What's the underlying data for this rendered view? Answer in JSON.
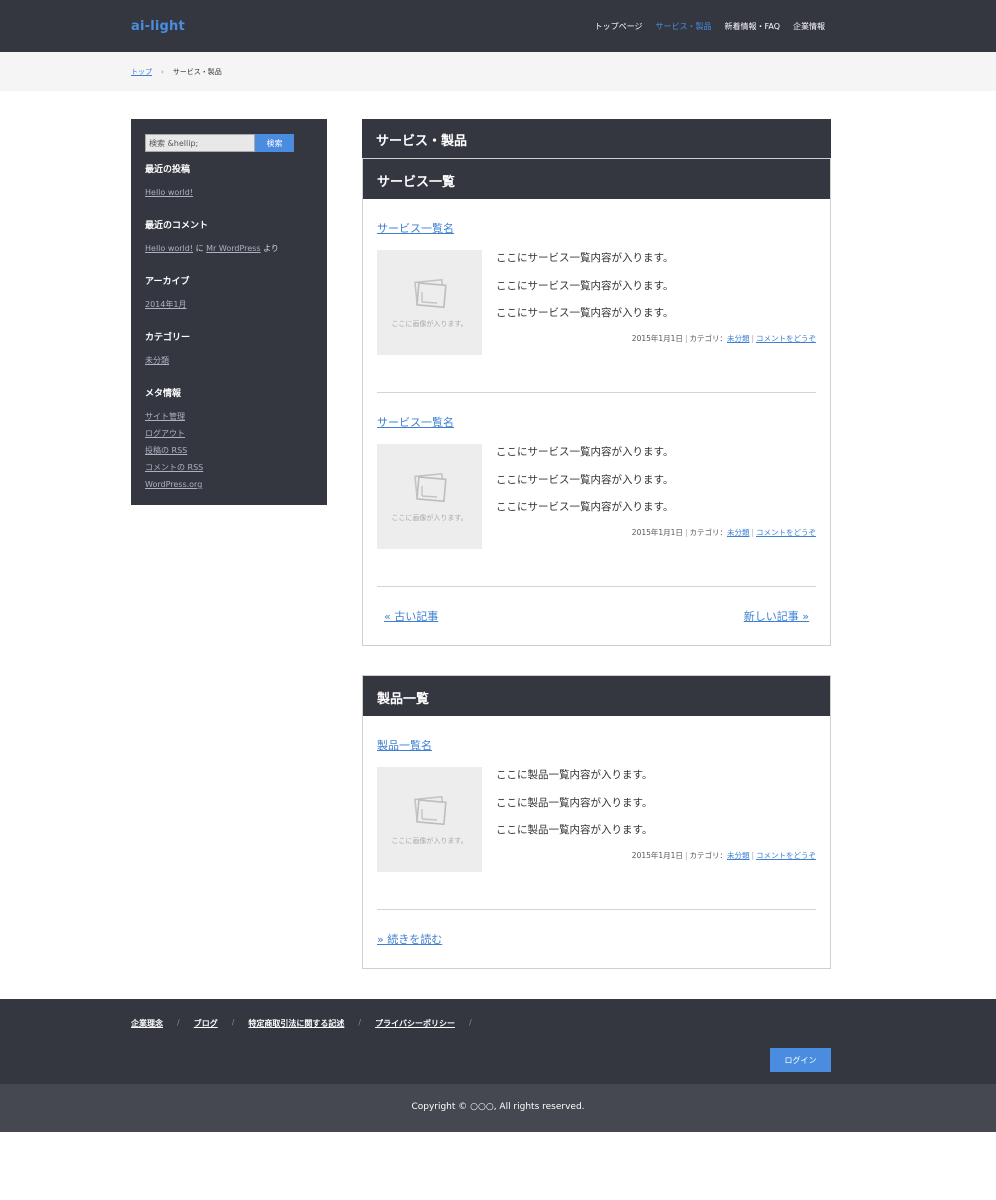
{
  "header": {
    "logo": "ai-light",
    "nav": [
      {
        "label": "トップページ",
        "active": false
      },
      {
        "label": "サービス・製品",
        "active": true
      },
      {
        "label": "新着情報・FAQ",
        "active": false
      },
      {
        "label": "企業情報",
        "active": false
      }
    ]
  },
  "breadcrumb": {
    "home": "トップ",
    "separator": "›",
    "current": "サービス・製品"
  },
  "sidebar": {
    "search": {
      "placeholder": "検索 &hellip;",
      "button": "検索"
    },
    "recent_posts": {
      "title": "最近の投稿",
      "items": [
        "Hello world!"
      ]
    },
    "recent_comments": {
      "title": "最近のコメント",
      "post": "Hello world!",
      "on": "に",
      "author": "Mr WordPress",
      "suffix": "より"
    },
    "archives": {
      "title": "アーカイブ",
      "items": [
        "2014年1月"
      ]
    },
    "categories": {
      "title": "カテゴリー",
      "items": [
        "未分類"
      ]
    },
    "meta": {
      "title": "メタ情報",
      "items": [
        "サイト管理",
        "ログアウト",
        "投稿の RSS",
        "コメントの RSS",
        "WordPress.org"
      ]
    }
  },
  "main": {
    "page_title": "サービス・製品",
    "services": {
      "title": "サービス一覧",
      "entries": [
        {
          "title": "サービス一覧名",
          "thumb_label": "ここに画像が入ります。",
          "lines": [
            "ここにサービス一覧内容が入ります。",
            "ここにサービス一覧内容が入ります。",
            "ここにサービス一覧内容が入ります。"
          ],
          "date": "2015年1月1日",
          "category_label": "カテゴリ：",
          "category": "未分類",
          "comment": "コメントをどうぞ"
        },
        {
          "title": "サービス一覧名",
          "thumb_label": "ここに画像が入ります。",
          "lines": [
            "ここにサービス一覧内容が入ります。",
            "ここにサービス一覧内容が入ります。",
            "ここにサービス一覧内容が入ります。"
          ],
          "date": "2015年1月1日",
          "category_label": "カテゴリ：",
          "category": "未分類",
          "comment": "コメントをどうぞ"
        }
      ],
      "pager": {
        "older": "« 古い記事",
        "newer": "新しい記事 »"
      }
    },
    "products": {
      "title": "製品一覧",
      "entries": [
        {
          "title": "製品一覧名",
          "thumb_label": "ここに画像が入ります。",
          "lines": [
            "ここに製品一覧内容が入ります。",
            "ここに製品一覧内容が入ります。",
            "ここに製品一覧内容が入ります。"
          ],
          "date": "2015年1月1日",
          "category_label": "カテゴリ：",
          "category": "未分類",
          "comment": "コメントをどうぞ"
        }
      ],
      "more": "» 続きを読む"
    }
  },
  "footer": {
    "links": [
      "企業理念",
      "ブログ",
      "特定商取引法に関する記述",
      "プライバシーポリシー"
    ],
    "separator": "/",
    "login": "ログイン",
    "copyright": "Copyright © ○○○, All rights reserved."
  },
  "colors": {
    "dark": "#343640",
    "accent": "#4a8de0",
    "link": "#3d7fd1"
  }
}
